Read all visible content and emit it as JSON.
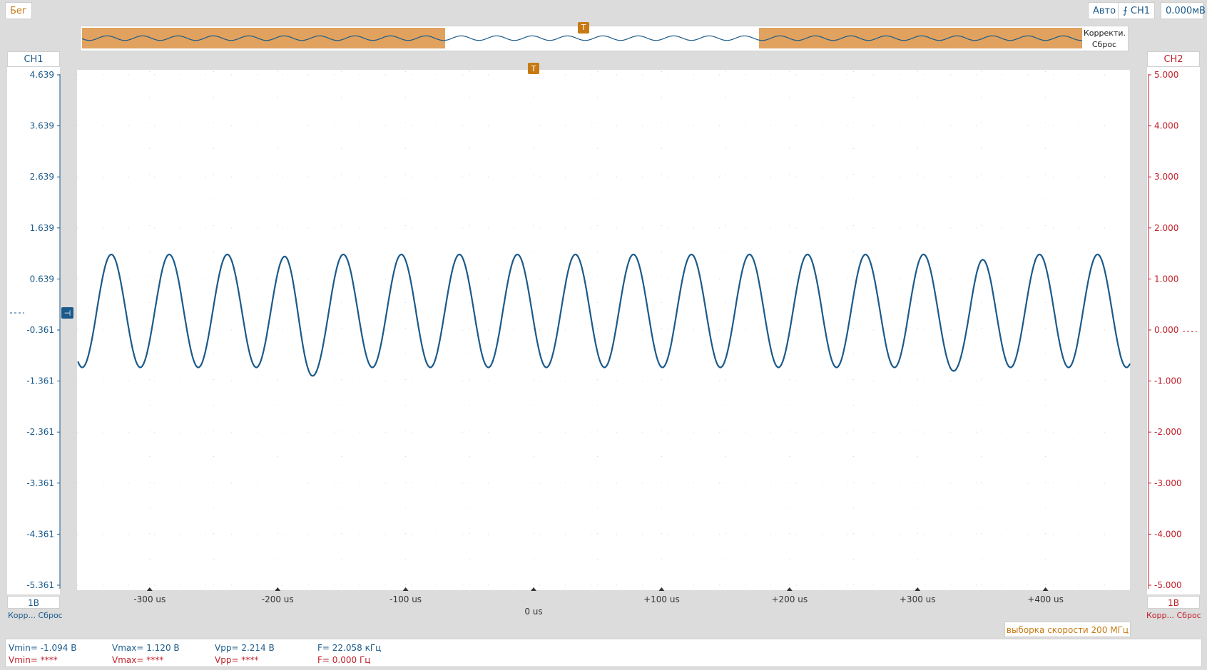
{
  "toolbar": {
    "run_label": "Бег",
    "trigger_mode_label": "Авто",
    "trigger_source_label": "CH1",
    "trigger_level_label": "0.000мВ"
  },
  "overview": {
    "correct_label": "Корректи...",
    "reset_label": "Сброс",
    "trigger_marker": "T"
  },
  "ch1": {
    "label": "CH1",
    "scale_label": "1В",
    "corr_label": "Корр...",
    "reset_label": "Сброс",
    "color": "#1b5a8a",
    "ticks": [
      "4.639",
      "3.639",
      "2.639",
      "1.639",
      "0.639",
      "-0.361",
      "-1.361",
      "-2.361",
      "-3.361",
      "-4.361",
      "-5.361"
    ]
  },
  "ch2": {
    "label": "CH2",
    "scale_label": "1В",
    "corr_label": "Корр...",
    "reset_label": "Сброс",
    "color": "#c0202a",
    "ticks": [
      "5.000",
      "4.000",
      "3.000",
      "2.000",
      "1.000",
      "0.000",
      "-1.000",
      "-2.000",
      "-3.000",
      "-4.000",
      "-5.000"
    ]
  },
  "plot": {
    "trigger_marker": "T",
    "x_ticks": [
      "-300 us",
      "-200 us",
      "-100 us",
      "0 us",
      "+100 us",
      "+200 us",
      "+300 us",
      "+400 us"
    ]
  },
  "sample_rate_label": "выборка скорости 200 МГц",
  "measurements": {
    "ch1": {
      "vmin": "Vmin= -1.094 В",
      "vmax": "Vmax= 1.120 В",
      "vpp": "Vpp= 2.214 В",
      "freq": "F= 22.058 кГц"
    },
    "ch2": {
      "vmin": "Vmin= ****",
      "vmax": "Vmax= ****",
      "vpp": "Vpp= ****",
      "freq": "F= 0.000 Гц"
    }
  },
  "chart_data": {
    "type": "line",
    "title": "",
    "xlabel": "",
    "ylabel": "",
    "xlim": [
      -356,
      466
    ],
    "ylim": [
      -5.361,
      4.639
    ],
    "series": [
      {
        "frequency_khz": 22.058,
        "vmin": -1.094,
        "vmax": 1.12,
        "glitches_at_us": [
          -180,
          340
        ]
      }
    ]
  }
}
